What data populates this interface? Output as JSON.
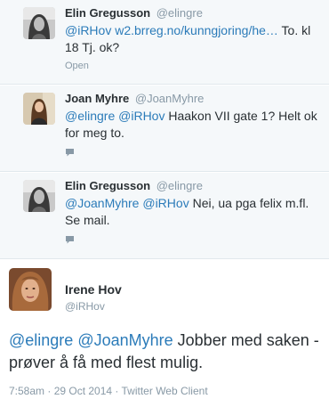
{
  "replies": [
    {
      "name": "Elin Gregusson",
      "handle": "@elingre",
      "mention1": "@iRHov",
      "link": "w2.brreg.no/kunngjoring/he…",
      "text": " To. kl 18 Tj. ok?",
      "action": "Open"
    },
    {
      "name": "Joan Myhre",
      "handle": "@JoanMyhre",
      "mention1": "@elingre",
      "mention2": "@iRHov",
      "text": " Haakon VII gate 1? Helt ok for meg to."
    },
    {
      "name": "Elin Gregusson",
      "handle": "@elingre",
      "mention1": "@JoanMyhre",
      "mention2": "@iRHov",
      "text": " Nei, ua pga felix m.fl. Se mail."
    }
  ],
  "main": {
    "name": "Irene Hov",
    "handle": "@iRHov",
    "mention1": "@elingre",
    "mention2": "@JoanMyhre",
    "text": " Jobber med saken - prøver å få med flest mulig.",
    "meta": "7:58am · 29 Oct 2014 · Twitter Web Client"
  },
  "colors": {
    "link": "#2b7bb9",
    "muted": "#8899a6",
    "text": "#292f33"
  },
  "icons": [
    "speech-bubble-icon"
  ]
}
